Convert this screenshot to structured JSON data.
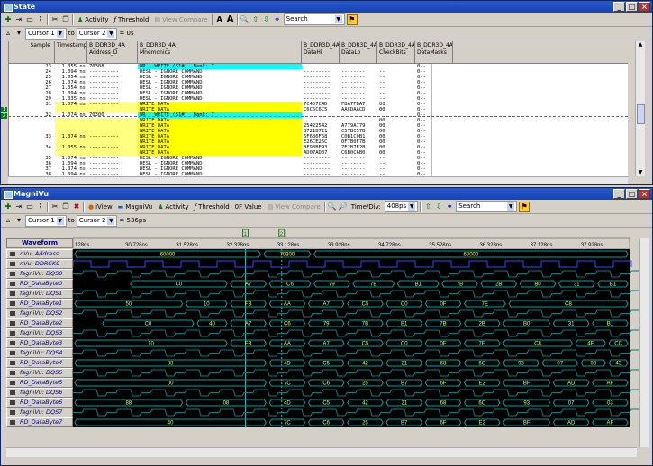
{
  "state_window": {
    "title": "State",
    "toolbar": {
      "activity_label": "Activity",
      "threshold_label": "Threshold",
      "view_compare_label": "View Compare",
      "search_value": "Search"
    },
    "cursor_bar": {
      "cursor1": "Cursor 1",
      "to": "to",
      "cursor2": "Cursor 2",
      "delta": "= 0s"
    },
    "columns": [
      "Sample",
      "Timestamp",
      "B_DDR3D_4A\nAddress_D",
      "B_DDR3D_4A\nMnemonics",
      "B_DDR3D_4A\nDataHi",
      "B_DDR3D_4A\nDataLo",
      "B_DDR3D_4A\nCheckBits",
      "B_DDR3D_4A\nDataMasks"
    ],
    "rows": [
      {
        "s": "23",
        "t": "1.055 ns",
        "a": "70308",
        "m": "WR - WRITE (S1#)  Bank: 7",
        "hi": "",
        "lo": "",
        "cb": "",
        "dm": "0--",
        "hl": "cyan"
      },
      {
        "s": "24",
        "t": "1.094 ns",
        "a": "----------",
        "m": "DESL - IGNORE COMMAND",
        "hi": "---------",
        "lo": "--------",
        "cb": "--",
        "dm": "0--",
        "hl": ""
      },
      {
        "s": "25",
        "t": "1.054 ns",
        "a": "----------",
        "m": "DESL - IGNORE COMMAND",
        "hi": "---------",
        "lo": "--------",
        "cb": "--",
        "dm": "0--",
        "hl": ""
      },
      {
        "s": "26",
        "t": "1.074 ns",
        "a": "----------",
        "m": "DESL - IGNORE COMMAND",
        "hi": "---------",
        "lo": "--------",
        "cb": "--",
        "dm": "0--",
        "hl": ""
      },
      {
        "s": "27",
        "t": "1.054 ns",
        "a": "----------",
        "m": "DESL - IGNORE COMMAND",
        "hi": "---------",
        "lo": "--------",
        "cb": "--",
        "dm": "0--",
        "hl": ""
      },
      {
        "s": "28",
        "t": "1.094 ns",
        "a": "----------",
        "m": "DESL - IGNORE COMMAND",
        "hi": "---------",
        "lo": "--------",
        "cb": "--",
        "dm": "0--",
        "hl": ""
      },
      {
        "s": "29",
        "t": "1.035 ns",
        "a": "----------",
        "m": "DESL - IGNORE COMMAND",
        "hi": "---------",
        "lo": "--------",
        "cb": "--",
        "dm": "0--",
        "hl": ""
      },
      {
        "s": "31",
        "t": "1.074 ns",
        "a": "----------",
        "m": "WRITE DATA",
        "hi": "7C4D7C4D",
        "lo": "FBA7FBA7",
        "cb": "00",
        "dm": "0--",
        "hl": "yel"
      },
      {
        "s": "",
        "t": "",
        "a": "",
        "m": "WRITE DATA",
        "hi": "C6C5C6C5",
        "lo": "AACDAACD",
        "cb": "00",
        "dm": "0--",
        "hl": "yel"
      },
      {
        "s": "32",
        "t": "1.074 ns",
        "a": "70300",
        "m": "WR - WRITE (S1#)  Bank: 7",
        "hi": "",
        "lo": "",
        "cb": "",
        "dm": "0--",
        "hl": "cyan"
      },
      {
        "s": "",
        "t": "",
        "a": "",
        "m": "WRITE DATA",
        "hi": "",
        "lo": "",
        "cb": "00",
        "dm": "0--",
        "hl": "yel"
      },
      {
        "s": "",
        "t": "",
        "a": "",
        "m": "WRITE DATA",
        "hi": "25422542",
        "lo": "A779A779",
        "cb": "00",
        "dm": "0--",
        "hl": "yel"
      },
      {
        "s": "",
        "t": "",
        "a": "",
        "m": "WRITE DATA",
        "hi": "B721B721",
        "lo": "C57BC57B",
        "cb": "00",
        "dm": "0--",
        "hl": "yel"
      },
      {
        "s": "33",
        "t": "1.074 ns",
        "a": "----------",
        "m": "WRITE DATA",
        "hi": "6F686F68",
        "lo": "C0B1C0B1",
        "cb": "00",
        "dm": "0--",
        "hl": "yel"
      },
      {
        "s": "",
        "t": "",
        "a": "",
        "m": "WRITE DATA",
        "hi": "E26CE26C",
        "lo": "0F7B0F7B",
        "cb": "00",
        "dm": "0--",
        "hl": "yel"
      },
      {
        "s": "34",
        "t": "1.055 ns",
        "a": "----------",
        "m": "WRITE DATA",
        "hi": "BF93BF93",
        "lo": "7E2B7E2B",
        "cb": "00",
        "dm": "0--",
        "hl": "yel"
      },
      {
        "s": "",
        "t": "",
        "a": "",
        "m": "WRITE DATA",
        "hi": "AD07AD07",
        "lo": "C6B0C6B0",
        "cb": "00",
        "dm": "0--",
        "hl": "yel"
      },
      {
        "s": "35",
        "t": "1.074 ns",
        "a": "----------",
        "m": "DESL - IGNORE COMMAND",
        "hi": "---------",
        "lo": "--------",
        "cb": "--",
        "dm": "0--",
        "hl": ""
      },
      {
        "s": "36",
        "t": "1.094 ns",
        "a": "----------",
        "m": "DESL - IGNORE COMMAND",
        "hi": "---------",
        "lo": "--------",
        "cb": "--",
        "dm": "0--",
        "hl": ""
      },
      {
        "s": "37",
        "t": "1.074 ns",
        "a": "----------",
        "m": "DESL - IGNORE COMMAND",
        "hi": "---------",
        "lo": "--------",
        "cb": "--",
        "dm": "0--",
        "hl": ""
      },
      {
        "s": "38",
        "t": "1.094 ns",
        "a": "----------",
        "m": "DESL - IGNORE COMMAND",
        "hi": "---------",
        "lo": "--------",
        "cb": "--",
        "dm": "0--",
        "hl": ""
      },
      {
        "s": "39",
        "t": "1.054 ns",
        "a": "----------",
        "m": "DESL - IGNORE COMMAND",
        "hi": "---------",
        "lo": "--------",
        "cb": "--",
        "dm": "0--",
        "hl": ""
      }
    ]
  },
  "magnivu_window": {
    "title": "MagniVu",
    "toolbar": {
      "iview_label": "iView",
      "magnivu_label": "MagniVu",
      "activity_label": "Activity",
      "threshold_label": "Threshold",
      "threshold_value": "0F Value",
      "view_compare_label": "View Compare",
      "timediv_label": "Time/Div:",
      "timediv_value": "408ps",
      "search_value": "Search"
    },
    "cursor_bar": {
      "cursor1": "Cursor 1",
      "to": "to",
      "cursor2": "Cursor 2",
      "delta": "= 536ps"
    },
    "waveform_header": "Waveform",
    "time_ticks": [
      "128ns",
      "30.728ns",
      "31.528ns",
      "32.328ns",
      "33.128ns",
      "33.928ns",
      "34.728ns",
      "35.528ns",
      "36.328ns",
      "37.128ns",
      "37.928ns"
    ],
    "cursor_markers": [
      "1",
      "2"
    ],
    "signals": [
      {
        "name": "nVu: Address",
        "segs": [
          {
            "v": "60000",
            "a": 0,
            "b": 0.34
          },
          {
            "v": "70300",
            "a": 0.34,
            "b": 0.43
          },
          {
            "v": "60000",
            "a": 0.43,
            "b": 1
          }
        ],
        "kind": "bus"
      },
      {
        "name": "nVu: DDRCK0",
        "kind": "clk"
      },
      {
        "name": "fagniVu: DQS0",
        "kind": "dqs"
      },
      {
        "name": "RD_DataByte0",
        "kind": "bus",
        "segs": [
          {
            "v": "C0",
            "a": 0.1,
            "b": 0.28
          },
          {
            "v": "A7",
            "a": 0.28,
            "b": 0.35
          },
          {
            "v": "C6",
            "a": 0.35,
            "b": 0.43
          },
          {
            "v": "79",
            "a": 0.43,
            "b": 0.5
          },
          {
            "v": "7B",
            "a": 0.5,
            "b": 0.58
          },
          {
            "v": "B1",
            "a": 0.58,
            "b": 0.66
          },
          {
            "v": "7B",
            "a": 0.66,
            "b": 0.73
          },
          {
            "v": "2B",
            "a": 0.73,
            "b": 0.8
          },
          {
            "v": "B0",
            "a": 0.8,
            "b": 0.87
          },
          {
            "v": "31",
            "a": 0.87,
            "b": 0.94
          },
          {
            "v": "B1",
            "a": 0.94,
            "b": 1
          }
        ]
      },
      {
        "name": "fagniVu: DQS1",
        "kind": "dqs"
      },
      {
        "name": "RD_DataByte1",
        "kind": "bus",
        "segs": [
          {
            "v": "50",
            "a": 0,
            "b": 0.2
          },
          {
            "v": "10",
            "a": 0.2,
            "b": 0.28
          },
          {
            "v": "FB",
            "a": 0.28,
            "b": 0.35
          },
          {
            "v": "AA",
            "a": 0.35,
            "b": 0.42
          },
          {
            "v": "A7",
            "a": 0.42,
            "b": 0.49
          },
          {
            "v": "C5",
            "a": 0.49,
            "b": 0.56
          },
          {
            "v": "C0",
            "a": 0.56,
            "b": 0.63
          },
          {
            "v": "0F",
            "a": 0.63,
            "b": 0.7
          },
          {
            "v": "7E",
            "a": 0.7,
            "b": 0.78
          },
          {
            "v": "C8",
            "a": 0.78,
            "b": 1
          }
        ]
      },
      {
        "name": "fagniVu: DQS2",
        "kind": "dqs"
      },
      {
        "name": "RD_DataByte2",
        "kind": "bus",
        "segs": [
          {
            "v": "C0",
            "a": 0.05,
            "b": 0.22
          },
          {
            "v": "40",
            "a": 0.22,
            "b": 0.28
          },
          {
            "v": "A7",
            "a": 0.28,
            "b": 0.35
          },
          {
            "v": "C6",
            "a": 0.35,
            "b": 0.42
          },
          {
            "v": "79",
            "a": 0.42,
            "b": 0.49
          },
          {
            "v": "7B",
            "a": 0.49,
            "b": 0.56
          },
          {
            "v": "B1",
            "a": 0.56,
            "b": 0.63
          },
          {
            "v": "7B",
            "a": 0.63,
            "b": 0.7
          },
          {
            "v": "2B",
            "a": 0.7,
            "b": 0.77
          },
          {
            "v": "B0",
            "a": 0.77,
            "b": 0.86
          },
          {
            "v": "31",
            "a": 0.86,
            "b": 0.93
          },
          {
            "v": "B1",
            "a": 0.93,
            "b": 1
          }
        ]
      },
      {
        "name": "fagniVu: DQS3",
        "kind": "dqs"
      },
      {
        "name": "RD_DataByte3",
        "kind": "bus",
        "segs": [
          {
            "v": "10",
            "a": 0,
            "b": 0.28
          },
          {
            "v": "FB",
            "a": 0.28,
            "b": 0.35
          },
          {
            "v": "AA",
            "a": 0.35,
            "b": 0.42
          },
          {
            "v": "A7",
            "a": 0.42,
            "b": 0.49
          },
          {
            "v": "C5",
            "a": 0.49,
            "b": 0.56
          },
          {
            "v": "C0",
            "a": 0.56,
            "b": 0.63
          },
          {
            "v": "0F",
            "a": 0.63,
            "b": 0.7
          },
          {
            "v": "7E",
            "a": 0.7,
            "b": 0.77
          },
          {
            "v": "C8",
            "a": 0.77,
            "b": 0.9
          },
          {
            "v": "4F",
            "a": 0.9,
            "b": 0.96
          },
          {
            "v": "CC",
            "a": 0.96,
            "b": 1
          }
        ]
      },
      {
        "name": "fagniVu: DQS4",
        "kind": "dqs"
      },
      {
        "name": "RD_DataByte4",
        "kind": "bus",
        "segs": [
          {
            "v": "88",
            "a": 0,
            "b": 0.35
          },
          {
            "v": "4D",
            "a": 0.35,
            "b": 0.42
          },
          {
            "v": "C5",
            "a": 0.42,
            "b": 0.49
          },
          {
            "v": "42",
            "a": 0.49,
            "b": 0.56
          },
          {
            "v": "21",
            "a": 0.56,
            "b": 0.63
          },
          {
            "v": "68",
            "a": 0.63,
            "b": 0.7
          },
          {
            "v": "6C",
            "a": 0.7,
            "b": 0.77
          },
          {
            "v": "93",
            "a": 0.77,
            "b": 0.84
          },
          {
            "v": "07",
            "a": 0.84,
            "b": 0.91
          },
          {
            "v": "03",
            "a": 0.91,
            "b": 0.96
          },
          {
            "v": "43",
            "a": 0.96,
            "b": 1
          }
        ]
      },
      {
        "name": "fagniVu: DQS5",
        "kind": "dqs"
      },
      {
        "name": "RD_DataByte5",
        "kind": "bus",
        "segs": [
          {
            "v": "00",
            "a": 0,
            "b": 0.35
          },
          {
            "v": "7C",
            "a": 0.35,
            "b": 0.42
          },
          {
            "v": "C6",
            "a": 0.42,
            "b": 0.49
          },
          {
            "v": "25",
            "a": 0.49,
            "b": 0.56
          },
          {
            "v": "B7",
            "a": 0.56,
            "b": 0.63
          },
          {
            "v": "6F",
            "a": 0.63,
            "b": 0.7
          },
          {
            "v": "E2",
            "a": 0.7,
            "b": 0.77
          },
          {
            "v": "BF",
            "a": 0.77,
            "b": 0.86
          },
          {
            "v": "AD",
            "a": 0.86,
            "b": 0.93
          },
          {
            "v": "AF",
            "a": 0.93,
            "b": 1
          }
        ]
      },
      {
        "name": "fagniVu: DQS6",
        "kind": "dqs"
      },
      {
        "name": "RD_DataByte6",
        "kind": "bus",
        "segs": [
          {
            "v": "88",
            "a": 0,
            "b": 0.2
          },
          {
            "v": "08",
            "a": 0.2,
            "b": 0.35
          },
          {
            "v": "4D",
            "a": 0.35,
            "b": 0.42
          },
          {
            "v": "C5",
            "a": 0.42,
            "b": 0.49
          },
          {
            "v": "42",
            "a": 0.49,
            "b": 0.56
          },
          {
            "v": "21",
            "a": 0.56,
            "b": 0.63
          },
          {
            "v": "68",
            "a": 0.63,
            "b": 0.7
          },
          {
            "v": "6C",
            "a": 0.7,
            "b": 0.77
          },
          {
            "v": "93",
            "a": 0.77,
            "b": 0.86
          },
          {
            "v": "07",
            "a": 0.86,
            "b": 0.93
          },
          {
            "v": "03",
            "a": 0.93,
            "b": 1
          }
        ]
      },
      {
        "name": "fagniVu: DQS7",
        "kind": "dqs"
      },
      {
        "name": "RD_DataByte7",
        "kind": "bus",
        "segs": [
          {
            "v": "40",
            "a": 0,
            "b": 0.35
          },
          {
            "v": "7C",
            "a": 0.35,
            "b": 0.42
          },
          {
            "v": "C6",
            "a": 0.42,
            "b": 0.49
          },
          {
            "v": "25",
            "a": 0.49,
            "b": 0.56
          },
          {
            "v": "B7",
            "a": 0.56,
            "b": 0.63
          },
          {
            "v": "6F",
            "a": 0.63,
            "b": 0.7
          },
          {
            "v": "E2",
            "a": 0.7,
            "b": 0.77
          },
          {
            "v": "BF",
            "a": 0.77,
            "b": 0.86
          },
          {
            "v": "AD",
            "a": 0.86,
            "b": 0.93
          },
          {
            "v": "AF",
            "a": 0.93,
            "b": 1
          }
        ]
      }
    ]
  },
  "colors": {
    "bus": "#00a0a0",
    "clk": "#4040ff",
    "text": "#ffff00",
    "bg": "#000000",
    "cursor": "#40c0c0"
  }
}
